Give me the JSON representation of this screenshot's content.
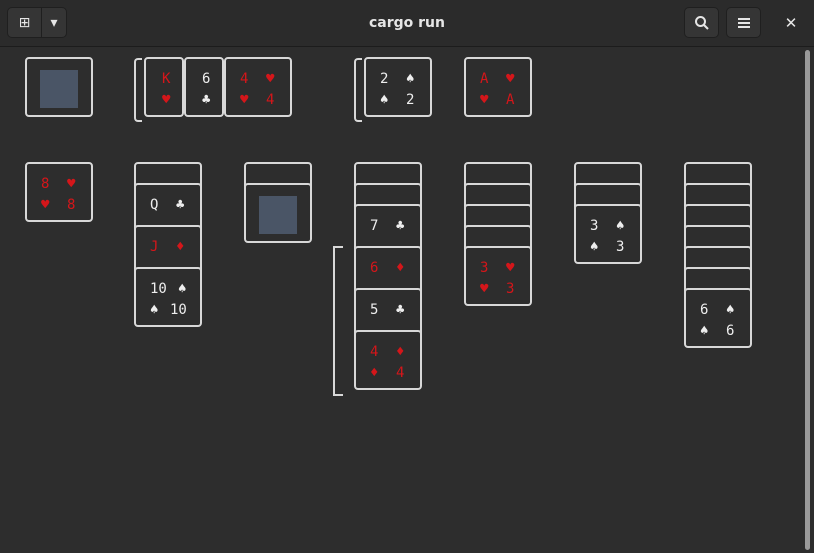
{
  "window": {
    "title": "cargo run",
    "close_glyph": "✕"
  },
  "toolbar": {
    "new_glyph": "⊞",
    "dropdown_glyph": "▾",
    "search_glyph": "⌕",
    "menu_glyph": "☰"
  },
  "colors": {
    "background": "#2d2d2d",
    "red_suit": "#d4161a",
    "black_suit": "#eeeeee",
    "empty_slot": "#4a5566"
  },
  "stock": {
    "state": "empty"
  },
  "waste": [
    {
      "rank": "K",
      "suit": "♥"
    },
    {
      "rank": "6",
      "suit": "♣"
    },
    {
      "rank": "4",
      "suit": "♥"
    }
  ],
  "foundations": [
    {
      "rank": "2",
      "suit": "♠"
    },
    {
      "rank": "A",
      "suit": "♥"
    }
  ],
  "tableau": [
    {
      "face_down": 0,
      "face_up": [
        {
          "rank": "8",
          "suit": "♥"
        }
      ]
    },
    {
      "face_down": 1,
      "face_up": [
        {
          "rank": "Q",
          "suit": "♣"
        },
        {
          "rank": "J",
          "suit": "♦"
        },
        {
          "rank": "10",
          "suit": "♠"
        }
      ]
    },
    {
      "face_down": 1,
      "face_up": []
    },
    {
      "face_down": 2,
      "face_up": [
        {
          "rank": "7",
          "suit": "♣"
        },
        {
          "rank": "6",
          "suit": "♦"
        },
        {
          "rank": "5",
          "suit": "♣"
        },
        {
          "rank": "4",
          "suit": "♦"
        }
      ]
    },
    {
      "face_down": 4,
      "face_up": [
        {
          "rank": "3",
          "suit": "♥"
        }
      ]
    },
    {
      "face_down": 2,
      "face_up": [
        {
          "rank": "3",
          "suit": "♠"
        }
      ]
    },
    {
      "face_down": 6,
      "face_up": [
        {
          "rank": "6",
          "suit": "♠"
        }
      ]
    }
  ]
}
